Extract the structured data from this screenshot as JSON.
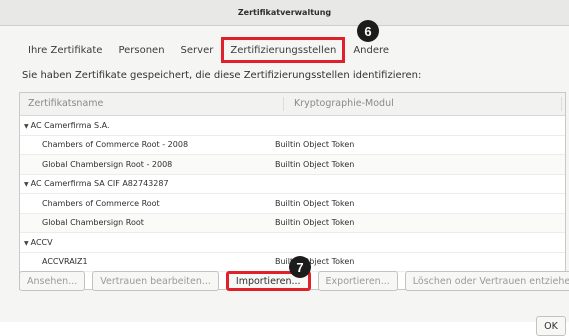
{
  "window": {
    "title": "Zertifikatverwaltung"
  },
  "tabs": [
    {
      "label": "Ihre Zertifikate"
    },
    {
      "label": "Personen"
    },
    {
      "label": "Server"
    },
    {
      "label": "Zertifizierungsstellen"
    },
    {
      "label": "Andere"
    }
  ],
  "info_text": "Sie haben Zertifikate gespeichert, die diese Zertifizierungsstellen identifizieren:",
  "table": {
    "headers": [
      "Zertifikatsname",
      "Kryptographie-Modul"
    ],
    "rows": [
      {
        "name": "AC Camerfirma S.A.",
        "module": ""
      },
      {
        "name": "Chambers of Commerce Root - 2008",
        "module": "Builtin Object Token"
      },
      {
        "name": "Global Chambersign Root - 2008",
        "module": "Builtin Object Token"
      },
      {
        "name": "AC Camerfirma SA CIF A82743287",
        "module": ""
      },
      {
        "name": "Chambers of Commerce Root",
        "module": "Builtin Object Token"
      },
      {
        "name": "Global Chambersign Root",
        "module": "Builtin Object Token"
      },
      {
        "name": "ACCV",
        "module": ""
      },
      {
        "name": "ACCVRAIZ1",
        "module": "Builtin Object Token"
      }
    ]
  },
  "buttons": {
    "view": "Ansehen...",
    "edit_trust": "Vertrauen bearbeiten...",
    "import": "Importieren...",
    "export": "Exportieren...",
    "delete": "Löschen oder Vertrauen entziehen...",
    "ok": "OK"
  },
  "annotations": {
    "badge_6": "6",
    "badge_7": "7"
  },
  "colors": {
    "highlight": "#e0202b",
    "badge": "#1c1c1c"
  }
}
